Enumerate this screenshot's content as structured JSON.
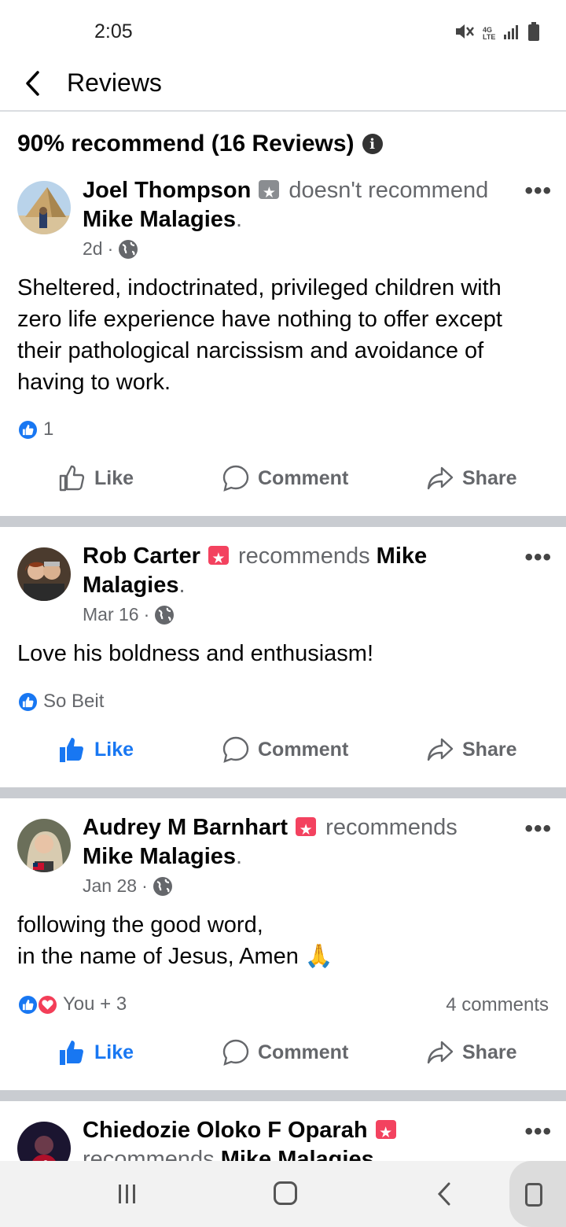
{
  "status_bar": {
    "time": "2:05",
    "signal_label": "4G LTE"
  },
  "header": {
    "title": "Reviews"
  },
  "summary": {
    "text": "90% recommend (16 Reviews)"
  },
  "reviews": [
    {
      "name": "Joel Thompson",
      "verb": "doesn't recommend",
      "target": "Mike Malagies",
      "time": "2d",
      "text": "Sheltered, indoctrinated, privileged children with zero life experience have nothing to offer except their pathological narcissism and avoidance of having to work.",
      "reactions": "1",
      "like_label": "Like",
      "comment_label": "Comment",
      "share_label": "Share"
    },
    {
      "name": "Rob Carter",
      "verb": "recommends",
      "target": "Mike Malagies",
      "time": "Mar 16",
      "text": "Love his boldness and enthusiasm!",
      "reactions": "So Beit",
      "like_label": "Like",
      "comment_label": "Comment",
      "share_label": "Share"
    },
    {
      "name": "Audrey M Barnhart",
      "verb": "recommends",
      "target": "Mike Malagies",
      "time": "Jan 28",
      "text_line1": "following the good word,",
      "text_line2": "in the name of Jesus, Amen 🙏",
      "reactions": "You + 3",
      "comments": "4 comments",
      "like_label": "Like",
      "comment_label": "Comment",
      "share_label": "Share"
    },
    {
      "name": "Chiedozie Oloko F Oparah",
      "verb": "recommends",
      "target": "Mike Malagies"
    }
  ],
  "colors": {
    "accent": "#1877f2",
    "secondary_text": "#65676b",
    "divider": "#c9ccd1",
    "recommend_badge": "#f3425f",
    "not_recommend_badge": "#8a8d91"
  }
}
